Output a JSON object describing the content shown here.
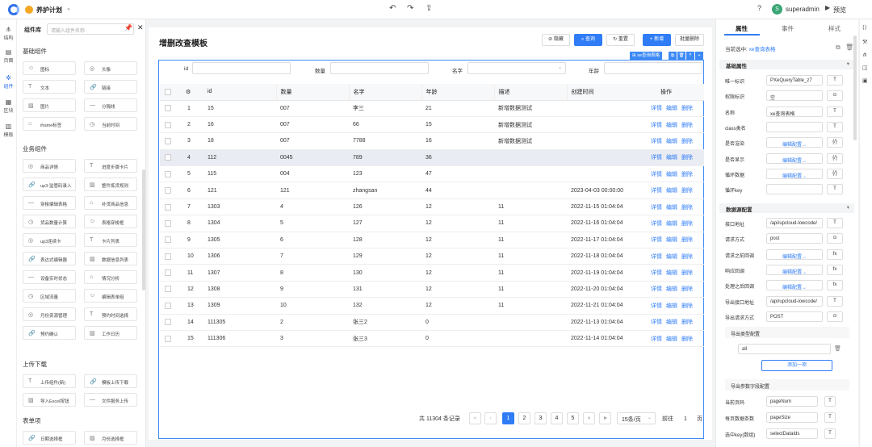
{
  "topbar": {
    "project": "养护计划",
    "user_initial": "S",
    "user": "superadmin",
    "preview": "预览"
  },
  "rail": [
    {
      "label": "结构",
      "icon": "⋔"
    },
    {
      "label": "页面",
      "icon": "▤"
    },
    {
      "label": "组件",
      "icon": "✲"
    },
    {
      "label": "区块",
      "icon": "▦"
    },
    {
      "label": "模板",
      "icon": "▥"
    }
  ],
  "cpanel": {
    "title": "组件库",
    "search_placeholder": "请输入组件名称",
    "sections": [
      {
        "title": "基础组件",
        "items": [
          "图标",
          "头像",
          "文本",
          "链接",
          "图片",
          "分隔线",
          "iframe标签",
          "当前时间"
        ]
      },
      {
        "title": "业务组件",
        "items": [
          "商品详情",
          "进度步骤卡片",
          "up3-监管码录入",
          "整件拣货规则",
          "穿梭编辑表格",
          "补货商品信息",
          "货品数量计算",
          "表格穿梭框",
          "up3连续卡",
          "卡片列表",
          "表达式编辑器",
          "数据信息列表",
          "设备实时状态",
          "情况分析",
          "区域流量",
          "编辑表单组",
          "月份资源管理",
          "预约时间选择",
          "预约确认",
          "工作日历"
        ]
      },
      {
        "title": "上传下载",
        "items": [
          "上传组件(新)",
          "模板上传下载",
          "导入Excel按钮",
          "文件服务上传"
        ]
      },
      {
        "title": "表单项",
        "items": [
          "日期选择框",
          "月份选择框"
        ]
      }
    ]
  },
  "main": {
    "title": "增删改查模板",
    "btn_hide": "隐藏",
    "btn_search": "查询",
    "btn_reset": "重置",
    "btn_add": "新增",
    "btn_batch_delete": "批量删除",
    "selected_tag": "xe查询表格",
    "filters": [
      {
        "label": "id"
      },
      {
        "label": "数量"
      },
      {
        "label": "名字"
      },
      {
        "label": "年龄"
      }
    ],
    "columns": [
      "id",
      "数量",
      "名字",
      "年龄",
      "描述",
      "创建时间",
      "操作"
    ],
    "actions": [
      "详情",
      "编辑",
      "删除"
    ],
    "rows": [
      [
        "1",
        "15",
        "007",
        "李三",
        "21",
        "新增数据测试",
        ""
      ],
      [
        "2",
        "16",
        "007",
        "66",
        "15",
        "新增数据测试",
        ""
      ],
      [
        "3",
        "18",
        "007",
        "7788",
        "16",
        "新增数据测试",
        ""
      ],
      [
        "4",
        "112",
        "0045",
        "789",
        "36",
        "",
        ""
      ],
      [
        "5",
        "115",
        "004",
        "123",
        "47",
        "",
        ""
      ],
      [
        "6",
        "121",
        "121",
        "zhangsan",
        "44",
        "",
        "2023-04-03 00:00:00"
      ],
      [
        "7",
        "1303",
        "4",
        "126",
        "12",
        "11",
        "2022-11-15 01:04:04"
      ],
      [
        "8",
        "1304",
        "5",
        "127",
        "12",
        "11",
        "2022-11-16 01:04:04"
      ],
      [
        "9",
        "1305",
        "6",
        "128",
        "12",
        "11",
        "2022-11-17 01:04:04"
      ],
      [
        "10",
        "1306",
        "7",
        "129",
        "12",
        "11",
        "2022-11-18 01:04:04"
      ],
      [
        "11",
        "1307",
        "8",
        "130",
        "12",
        "11",
        "2022-11-19 01:04:04"
      ],
      [
        "12",
        "1308",
        "9",
        "131",
        "12",
        "11",
        "2022-11-20 01:04:04"
      ],
      [
        "13",
        "1309",
        "10",
        "132",
        "12",
        "11",
        "2022-11-21 01:04:04"
      ],
      [
        "14",
        "111305",
        "2",
        "张三2",
        "0",
        "",
        "2022-11-13 01:04:04"
      ],
      [
        "15",
        "111306",
        "3",
        "张三3",
        "0",
        "",
        "2022-11-14 01:04:04"
      ]
    ],
    "pager": {
      "total": "共 11304 条记录",
      "pages": [
        "1",
        "2",
        "3",
        "4",
        "5"
      ],
      "page_size": "15条/页",
      "goto": "前往",
      "goto_value": "1",
      "page_suffix": "页"
    }
  },
  "rpanel": {
    "tabs": [
      "属性",
      "事件",
      "样式"
    ],
    "current_label": "当前选中:",
    "current_value": "xe查询表格",
    "group_basic": "基础属性",
    "basic": [
      {
        "label": "唯一标识",
        "value": "PXeQueryTable_z7",
        "icon": "T"
      },
      {
        "label": "权限标识",
        "value": "空",
        "icon": "⊙"
      },
      {
        "label": "名称",
        "value": "xe查询表格",
        "icon": "T"
      },
      {
        "label": "class类名",
        "value": "",
        "icon": "T"
      },
      {
        "label": "是否渲染",
        "value": "编辑配置→",
        "icon": "{/}"
      },
      {
        "label": "是否显示",
        "value": "编辑配置→",
        "icon": "{/}"
      },
      {
        "label": "循环数据",
        "value": "编辑配置→",
        "icon": "{/}"
      },
      {
        "label": "循环key",
        "value": "",
        "icon": "T"
      }
    ],
    "group_ds": "数据源配置",
    "ds": [
      {
        "label": "接口地址",
        "value": "/api/upcloud-lowcode/",
        "icon": "T"
      },
      {
        "label": "请求方式",
        "value": "post",
        "icon": "⊙"
      },
      {
        "label": "请求之前回调",
        "value": "编辑配置→",
        "icon": "fx"
      },
      {
        "label": "响应回调",
        "value": "编辑配置→",
        "icon": "fx"
      },
      {
        "label": "处理之后回调",
        "value": "编辑配置→",
        "icon": "fx"
      },
      {
        "label": "导出接口地址",
        "value": "/api/upcloud-lowcode/",
        "icon": "T"
      },
      {
        "label": "导出请求方式",
        "value": "POST",
        "icon": "⊙"
      }
    ],
    "export_type": "导出类型配置",
    "export_item": "all",
    "add_item": "添加一项",
    "export_params": "导出参数字段配置",
    "params": [
      {
        "label": "当前页码",
        "value": "pageNum"
      },
      {
        "label": "每页数据条数",
        "value": "pageSize"
      },
      {
        "label": "选中key(数组)",
        "value": "selectDataIds"
      }
    ]
  }
}
